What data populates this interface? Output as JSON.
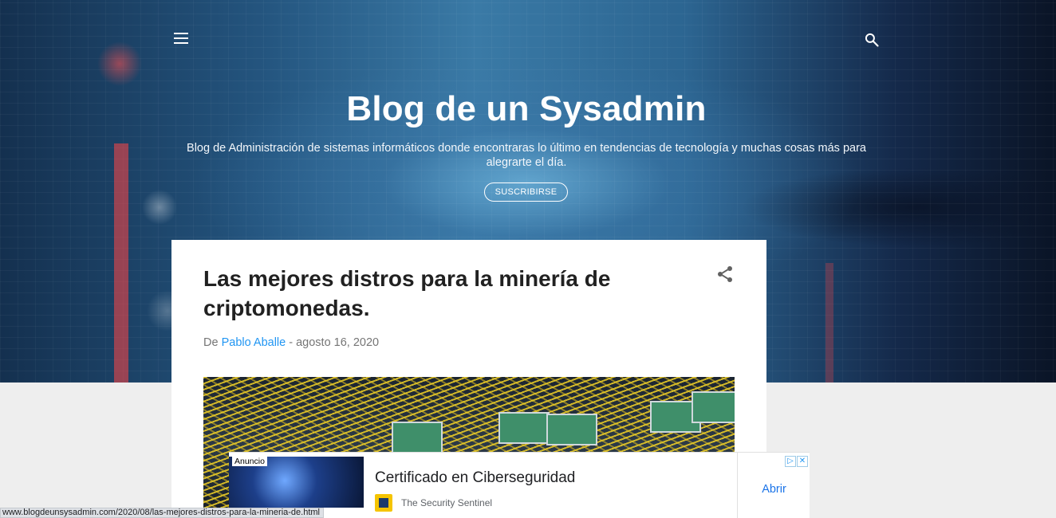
{
  "header": {
    "title": "Blog de un Sysadmin",
    "description": "Blog de Administración de sistemas informáticos donde encontraras lo último en tendencias de tecnología y muchas cosas más para alegrarte el día.",
    "subscribe_label": "SUSCRIBIRSE",
    "menu_icon": "hamburger-menu-icon",
    "search_icon": "search-icon"
  },
  "post": {
    "title": "Las mejores distros para la minería de criptomonedas.",
    "byline_prefix": "De",
    "author": "Pablo Aballe",
    "date_separator": "-",
    "date": "agosto 16, 2020",
    "share_icon": "share-icon"
  },
  "ad": {
    "label": "Anuncio",
    "title": "Certificado en Ciberseguridad",
    "brand": "The Security Sentinel",
    "cta": "Abrir",
    "choices_icon": "ad-choices-icon",
    "close_icon": "close-icon"
  },
  "status_bar": {
    "url": "www.blogdeunsysadmin.com/2020/08/las-mejores-distros-para-la-mineria-de.html"
  },
  "colors": {
    "link": "#2196f3",
    "title_text": "#212121",
    "meta_text": "#757575",
    "ad_cta": "#1a73e8",
    "page_bg": "#eeeeee"
  }
}
